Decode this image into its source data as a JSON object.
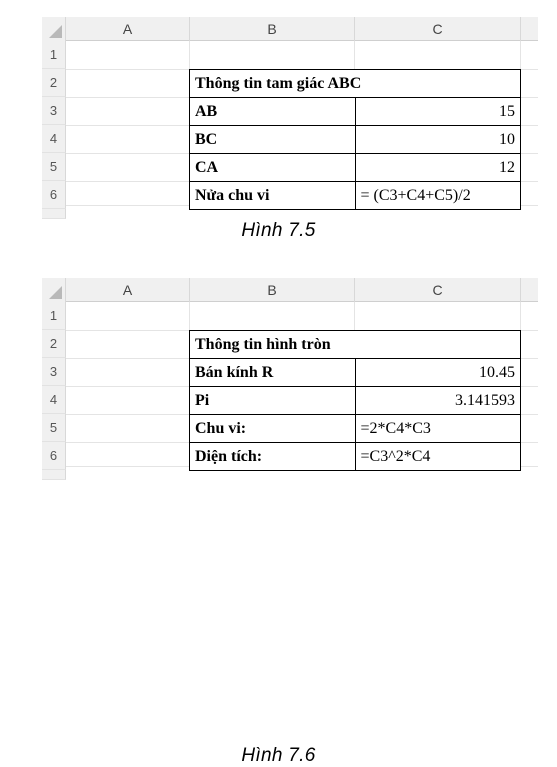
{
  "figures": [
    {
      "id": "fig-7-5",
      "caption": "Hình 7.5",
      "sheet": {
        "column_headers": [
          "A",
          "B",
          "C"
        ],
        "row_headers": [
          "1",
          "2",
          "3",
          "4",
          "5",
          "6"
        ],
        "table": {
          "title": "Thông tin tam giác ABC",
          "rows": [
            {
              "label": "AB",
              "value": "15",
              "value_type": "number"
            },
            {
              "label": "BC",
              "value": "10",
              "value_type": "number"
            },
            {
              "label": "CA",
              "value": "12",
              "value_type": "number"
            },
            {
              "label": "Nửa chu vi",
              "value": "= (C3+C4+C5)/2",
              "value_type": "formula"
            }
          ]
        }
      }
    },
    {
      "id": "fig-7-6",
      "caption": "Hình 7.6",
      "sheet": {
        "column_headers": [
          "A",
          "B",
          "C"
        ],
        "row_headers": [
          "1",
          "2",
          "3",
          "4",
          "5",
          "6"
        ],
        "table": {
          "title": "Thông tin hình tròn",
          "rows": [
            {
              "label": "Bán kính R",
              "value": "10.45",
              "value_type": "number"
            },
            {
              "label": "Pi",
              "value": "3.141593",
              "value_type": "number"
            },
            {
              "label": "Chu vi:",
              "value": "=2*C4*C3",
              "value_type": "formula"
            },
            {
              "label": "Diện tích:",
              "value": "=C3^2*C4",
              "value_type": "formula"
            }
          ]
        }
      }
    }
  ],
  "colors": {
    "header_band": "#f0f0f0",
    "gridline": "#e4e4e4",
    "table_border": "#000000",
    "page_background": "#ffffff"
  }
}
